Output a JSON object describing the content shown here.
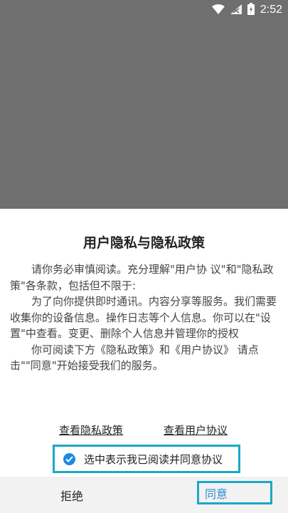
{
  "status_bar": {
    "time": "2:52",
    "icons": [
      "wifi-icon",
      "signal-icon",
      "battery-icon"
    ]
  },
  "dialog": {
    "title": "用户隐私与隐私政策",
    "paragraphs": [
      "请你务必审慎阅读。充分理解\"用户协 议\"和\"隐私政策\"各条款，包括但不限于:",
      "为了向你提供即时通讯。内容分享等服务。我们需要收集你的设备信息。操作日志等个人信息。你可以在\"设置\"中查看。变更、删除个人信息并管理你的授权",
      "你可阅读下方《隐私政策》和《用户协议》 请点击\"\"同意\"开始接受我们的服务。"
    ],
    "privacy_link": "查看隐私政策",
    "user_link": "查看用户协议",
    "agree_checkbox_label": "选中表示我已阅读并同意协议",
    "agree_checked": true
  },
  "buttons": {
    "reject": "拒绝",
    "agree": "同意"
  },
  "colors": {
    "overlay": "#6f6f6f",
    "highlight_border": "#1aa9c7",
    "checkbox": "#1e88e5",
    "agree_text": "#2d8fdc"
  }
}
